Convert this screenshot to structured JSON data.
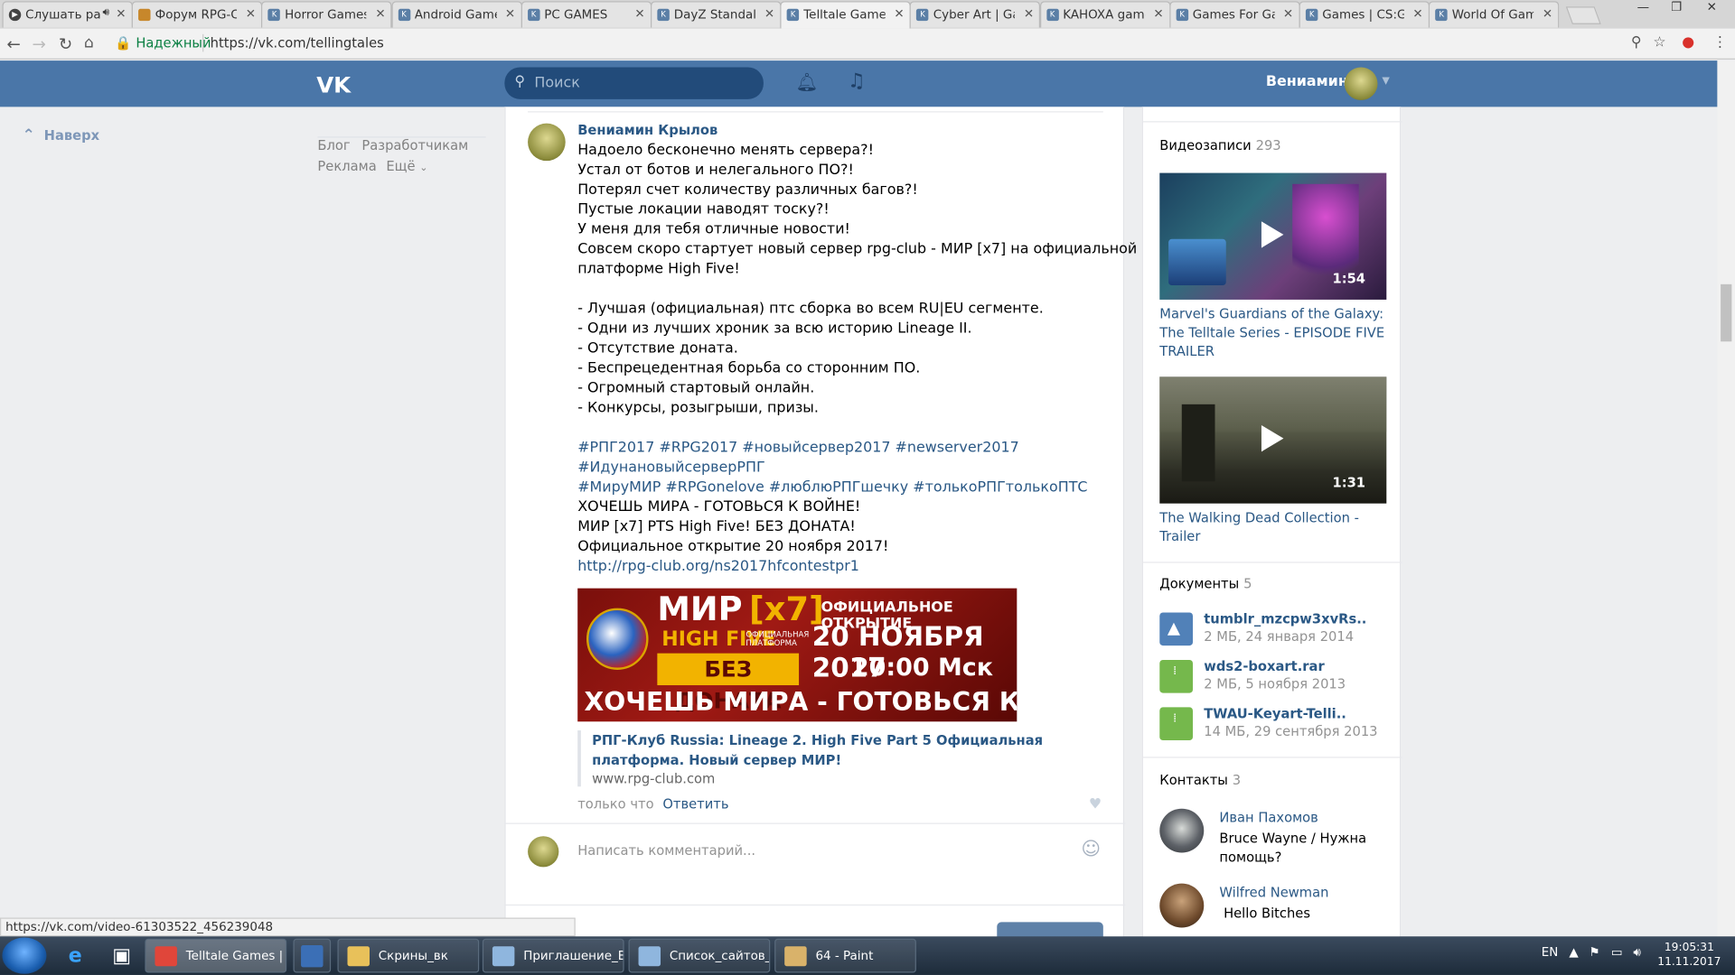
{
  "browser": {
    "tabs": [
      {
        "title": "Слушать ра",
        "icon": "play-icon"
      },
      {
        "title": "Форум RPG-CL",
        "icon": "forum-icon"
      },
      {
        "title": "Horror Games R",
        "icon": "vk-icon"
      },
      {
        "title": "Android Games",
        "icon": "vk-icon"
      },
      {
        "title": "PC GAMES",
        "icon": "vk-icon"
      },
      {
        "title": "DayZ Standalo",
        "icon": "vk-icon"
      },
      {
        "title": "Telltale Games",
        "icon": "vk-icon"
      },
      {
        "title": "Cyber Art | Gar",
        "icon": "vk-icon"
      },
      {
        "title": "KAHOXA game",
        "icon": "vk-icon"
      },
      {
        "title": "Games For Gam",
        "icon": "vk-icon"
      },
      {
        "title": "Games | CS:GO",
        "icon": "vk-icon"
      },
      {
        "title": "World Of Game",
        "icon": "vk-icon"
      }
    ],
    "secure_label": "Надежный",
    "url": "https://vk.com/tellingtales",
    "status_url": "https://vk.com/video-61303522_456239048"
  },
  "vk_header": {
    "logo": "VK",
    "search_placeholder": "Поиск",
    "user_name": "Вениамин"
  },
  "left": {
    "back_to_top": "Наверх",
    "links": [
      "Блог",
      "Разработчикам",
      "Реклама",
      "Ещё"
    ]
  },
  "post": {
    "author": "Вениамин Крылов",
    "lines": [
      "Надоело бесконечно менять сервера?!",
      "Устал от ботов и нелегального ПО?!",
      "Потерял счет количеству различных багов?!",
      "Пустые локации наводят тоску?!",
      "У меня для тебя отличные новости!",
      "Совсем скоро стартует новый сервер rpg-club - МИР [x7] на официальной",
      "платформе High Five!"
    ],
    "bullets": [
      "- Лучшая (официальная) птс сборка во всем RU|EU сегменте.",
      "- Одни из лучших хроник за всю историю Lineage II.",
      "- Отсутствие доната.",
      "- Беспрецедентная борьба со сторонним ПО.",
      "- Огромный стартовый онлайн.",
      "- Конкурсы, розыгрыши, призы."
    ],
    "tags_line1": "#РПГ2017 #RPG2017 #новыйсервер2017 #newserver2017",
    "tags_line2": "#ИдунановыйсерверРПГ",
    "tags_line3": "#МируМИР #RPGonelove #люблюРПГшечку #толькоРПГтолькоПТС",
    "after_tags": [
      "ХОЧЕШЬ МИРА - ГОТОВЬСЯ К ВОЙНЕ!",
      "МИР [x7] PTS High Five! БЕЗ ДОНАТА!",
      "Официальное открытие 20 ноября 2017!"
    ],
    "link": "http://rpg-club.org/ns2017hfcontestpr1",
    "banner": {
      "mir": "МИР",
      "x7": "[x7]",
      "official_open": "ОФИЦИАЛЬНОЕ ОТКРЫТИЕ",
      "high_five": "HIGH FIVE",
      "official_platform": "ОФИЦИАЛЬНАЯ ПЛАТФОРМА",
      "date": "20 НОЯБРЯ 2017",
      "no_donate": "БЕЗ ДОНАТА",
      "time": "20:00 Мск",
      "slogan": "ХОЧЕШЬ МИРА - ГОТОВЬСЯ К ВОЙНЕ"
    },
    "card_title": "РПГ-Клуб Russia: Lineage 2. High Five Part 5 Официальная платформа. Новый сервер МИР!",
    "card_domain": "www.rpg-club.com",
    "time": "только что",
    "reply": "Ответить",
    "comment_placeholder": "Написать комментарий..."
  },
  "right": {
    "videos_title": "Видеозаписи",
    "videos_count": "293",
    "videos": [
      {
        "title": "Marvel's Guardians of the Galaxy: The Telltale Series - EPISODE FIVE TRAILER",
        "duration": "1:54"
      },
      {
        "title": "The Walking Dead Collection - Trailer",
        "duration": "1:31"
      }
    ],
    "docs_title": "Документы",
    "docs_count": "5",
    "docs": [
      {
        "name": "tumblr_mzcpw3xvRs..",
        "meta": "2 МБ, 24 января 2014",
        "icon": "image-file-icon",
        "color": "#5181b8"
      },
      {
        "name": "wds2-boxart.rar",
        "meta": "2 МБ, 5 ноября 2013",
        "icon": "archive-file-icon",
        "color": "#75b84c"
      },
      {
        "name": "TWAU-Keyart-Telli..",
        "meta": "14 МБ, 29 сентября 2013",
        "icon": "archive-file-icon",
        "color": "#75b84c"
      }
    ],
    "contacts_title": "Контакты",
    "contacts_count": "3",
    "contacts": [
      {
        "name": "Иван Пахомов",
        "desc": "Bruce Wayne / Нужна помощь?"
      },
      {
        "name": "Wilfred Newman",
        "desc": " Hello Bitches"
      }
    ]
  },
  "taskbar": {
    "tasks": [
      {
        "title": "Telltale Games | T...",
        "color": "#e0463a"
      },
      {
        "title": "Скрины_вк",
        "color": "#e8c15a"
      },
      {
        "title": "Приглашение_В...",
        "color": "#8fb6de"
      },
      {
        "title": "Список_сайтов_в...",
        "color": "#8fb6de"
      },
      {
        "title": "64 - Paint",
        "color": "#d9b26a"
      }
    ],
    "lang": "EN",
    "time": "19:05:31",
    "date": "11.11.2017"
  }
}
